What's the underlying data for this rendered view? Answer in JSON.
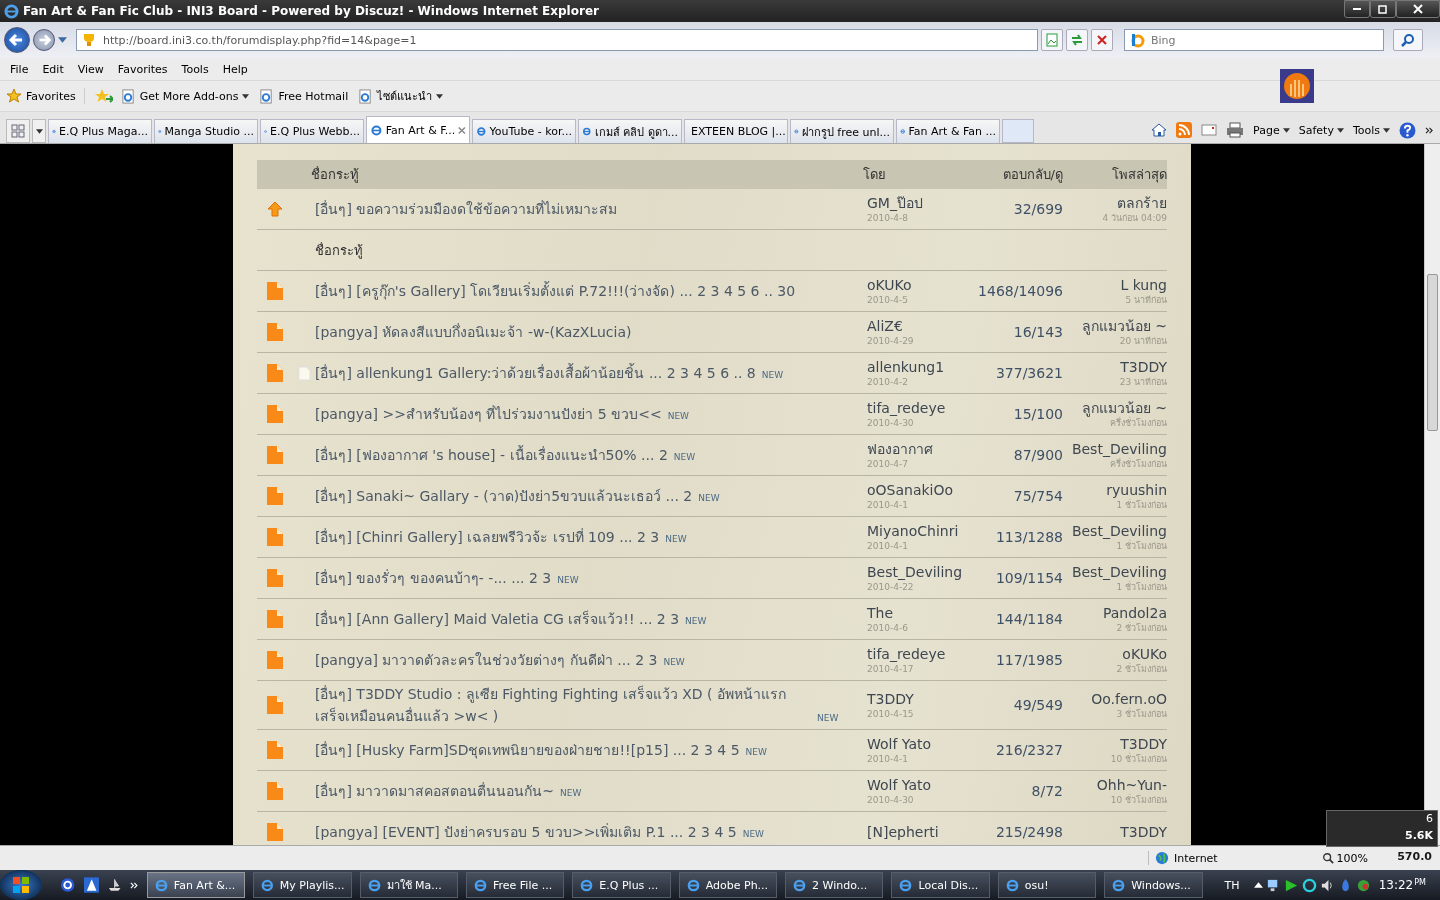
{
  "window": {
    "title": "Fan Art & Fan Fic Club - INI3 Board - Powered by Discuz! - Windows Internet Explorer"
  },
  "address_bar": {
    "url": "http://board.ini3.co.th/forumdisplay.php?fid=14&page=1",
    "search_placeholder": "Bing"
  },
  "menu": [
    "File",
    "Edit",
    "View",
    "Favorites",
    "Tools",
    "Help"
  ],
  "favorites_bar": {
    "label": "Favorites",
    "items": [
      {
        "label": "Get More Add-ons",
        "dropdown": true
      },
      {
        "label": "Free Hotmail",
        "dropdown": false
      },
      {
        "label": "ไซต์แนะนำ",
        "dropdown": true
      }
    ]
  },
  "tabs": [
    {
      "label": "E.Q Plus Maga...",
      "selected": false
    },
    {
      "label": "Manga Studio ...",
      "selected": false
    },
    {
      "label": "E.Q Plus Webb...",
      "selected": false
    },
    {
      "label": "Fan Art & F...",
      "selected": true
    },
    {
      "label": "YouTube - kor...",
      "selected": false
    },
    {
      "label": "เกมส์ คลิป ดูดา...",
      "selected": false
    },
    {
      "label": "EXTEEN BLOG |...",
      "selected": false
    },
    {
      "label": "ฝากรูป free unl...",
      "selected": false
    },
    {
      "label": "Fan Art & Fan ...",
      "selected": false
    }
  ],
  "command_bar": [
    "Page",
    "Safety",
    "Tools"
  ],
  "forum": {
    "columns": [
      "ชื่อกระทู้",
      "โดย",
      "ตอบกลับ/ดู",
      "โพสล่าสุด"
    ],
    "rows": [
      {
        "kind": "pinned",
        "title": "[อื่นๆ] ขอความร่วมมืองดใช้ข้อความที่ไม่เหมาะสม",
        "author": "GM_ป๊อป",
        "date": "2010-4-8",
        "counts": "32/699",
        "last_poster": "ตลกร้าย",
        "last_time": "4 วันก่อน 04:09"
      },
      {
        "kind": "section",
        "label": "ชื่อกระทู้"
      },
      {
        "kind": "thread",
        "title": "[อื่นๆ] [ครูกุ๊ก's Gallery] โดเวียนเริ่มตั้งแต่ P.72!!!(ว่างจัด) ... 2 3 4 5 6 .. 30",
        "author": "oKUKo",
        "date": "2010-4-5",
        "counts": "1468/14096",
        "last_poster": "L kung",
        "last_time": "5 นาทีก่อน"
      },
      {
        "kind": "thread",
        "title": "[pangya] หัดลงสีแบบกึ่งอนิเมะจ้า -w-(KazXLucia)",
        "author": "AliZ€",
        "date": "2010-4-29",
        "counts": "16/143",
        "last_poster": "ลูกแมวน้อย ~",
        "last_time": "20 นาทีก่อน"
      },
      {
        "kind": "thread",
        "attachment": true,
        "title": "[อื่นๆ] allenkung1 Gallery:ว่าด้วยเรื่องเสื้อผ้าน้อยชิ้น ... 2 3 4 5 6 .. 8",
        "badge": "NEW",
        "author": "allenkung1",
        "date": "2010-4-2",
        "counts": "377/3621",
        "last_poster": "T3DDY",
        "last_time": "23 นาทีก่อน"
      },
      {
        "kind": "thread",
        "title": "[pangya] >>สำหรับน้องๆ ที่ไปร่วมงานปังย่า 5 ขวบ<<",
        "badge": "NEW",
        "author": "tifa_redeye",
        "date": "2010-4-30",
        "counts": "15/100",
        "last_poster": "ลูกแมวน้อย ~",
        "last_time": "ครึ่งชั่วโมงก่อน"
      },
      {
        "kind": "thread",
        "title": "[อื่นๆ] [ฟองอากาศ 's house] - เนื้อเรื่องแนะนำ50% ... 2",
        "badge": "NEW",
        "author": "ฟองอากาศ",
        "date": "2010-4-7",
        "counts": "87/900",
        "last_poster": "Best_Deviling",
        "last_time": "ครึ่งชั่วโมงก่อน"
      },
      {
        "kind": "thread",
        "title": "[อื่นๆ] Sanaki~ Gallary - (วาด)ปังย่า5ขวบแล้วนะเธอว์ ... 2",
        "badge": "NEW",
        "author": "oOSanakiOo",
        "date": "2010-4-1",
        "counts": "75/754",
        "last_poster": "ryuushin",
        "last_time": "1 ชั่วโมงก่อน"
      },
      {
        "kind": "thread",
        "title": "[อื่นๆ] [Chinri Gallery] เฉลยพรีวิวจ้ะ เรปที่ 109 ... 2 3",
        "badge": "NEW",
        "author": "MiyanoChinri",
        "date": "2010-4-1",
        "counts": "113/1288",
        "last_poster": "Best_Deviling",
        "last_time": "1 ชั่วโมงก่อน"
      },
      {
        "kind": "thread",
        "title": "[อื่นๆ] ของรั่วๆ ของคนบ้าๆ- -... ... 2 3",
        "badge": "NEW",
        "author": "Best_Deviling",
        "date": "2010-4-22",
        "counts": "109/1154",
        "last_poster": "Best_Deviling",
        "last_time": "1 ชั่วโมงก่อน"
      },
      {
        "kind": "thread",
        "title": "[อื่นๆ] [Ann Gallery] Maid Valetia CG เสร็จแว้ว!! ... 2 3",
        "badge": "NEW",
        "author": "The",
        "date": "2010-4-6",
        "counts": "144/1184",
        "last_poster": "Pandol2a",
        "last_time": "2 ชั่วโมงก่อน"
      },
      {
        "kind": "thread",
        "title": "[pangya] มาวาดตัวละครในช่วงวัยต่างๆ กันดีฝ่า ... 2 3",
        "badge": "NEW",
        "author": "tifa_redeye",
        "date": "2010-4-17",
        "counts": "117/1985",
        "last_poster": "oKUKo",
        "last_time": "2 ชั่วโมงก่อน"
      },
      {
        "kind": "thread",
        "title": "[อื่นๆ] T3DDY Studio : ลูเซีย Fighting Fighting เสร็จแว้ว XD ( อัพหน้าแรกเสร็จเหมือนคนอื่นแล้ว >w< )",
        "badge": "NEW",
        "author": "T3DDY",
        "date": "2010-4-15",
        "counts": "49/549",
        "last_poster": "Oo.fern.oO",
        "last_time": "3 ชั่วโมงก่อน"
      },
      {
        "kind": "thread",
        "title": "[อื่นๆ] [Husky Farm]SDชุดเทพนิยายของฝ่ายชาย!![p15] ... 2 3 4 5",
        "badge": "NEW",
        "author": "Wolf Yato",
        "date": "2010-4-1",
        "counts": "216/2327",
        "last_poster": "T3DDY",
        "last_time": "10 ชั่วโมงก่อน"
      },
      {
        "kind": "thread",
        "title": "[อื่นๆ] มาวาดมาสคอสตอนตื่นนอนกัน~",
        "badge": "NEW",
        "author": "Wolf Yato",
        "date": "2010-4-30",
        "counts": "8/72",
        "last_poster": "Ohh~Yun-",
        "last_time": "10 ชั่วโมงก่อน"
      },
      {
        "kind": "thread",
        "title": "[pangya] [EVENT] ปังย่าครบรอบ 5 ขวบ>>เพิ่มเติม P.1 ... 2 3 4 5",
        "badge": "NEW",
        "author": "[N]epherti",
        "counts": "215/2498",
        "last_poster": "T3DDY"
      }
    ]
  },
  "status_bar": {
    "zone": "Internet",
    "zoom": "100%"
  },
  "net_meter": {
    "count": "6",
    "rate": "5.6K",
    "total": "570.0"
  },
  "taskbar": {
    "items": [
      {
        "label": "Fan Art &...",
        "selected": true
      },
      {
        "label": "My Playlis...",
        "selected": false
      },
      {
        "label": "มาใช้ Ma...",
        "selected": false
      },
      {
        "label": "Free File ...",
        "selected": false
      },
      {
        "label": "E.Q Plus ...",
        "selected": false
      },
      {
        "label": "Adobe Ph...",
        "selected": false
      },
      {
        "label": "2 Windo...",
        "selected": false
      },
      {
        "label": "Local Dis...",
        "selected": false
      },
      {
        "label": "osu!",
        "selected": false
      },
      {
        "label": "Windows...",
        "selected": false
      }
    ],
    "language": "TH",
    "time": "13:22",
    "ampm": "PM"
  }
}
